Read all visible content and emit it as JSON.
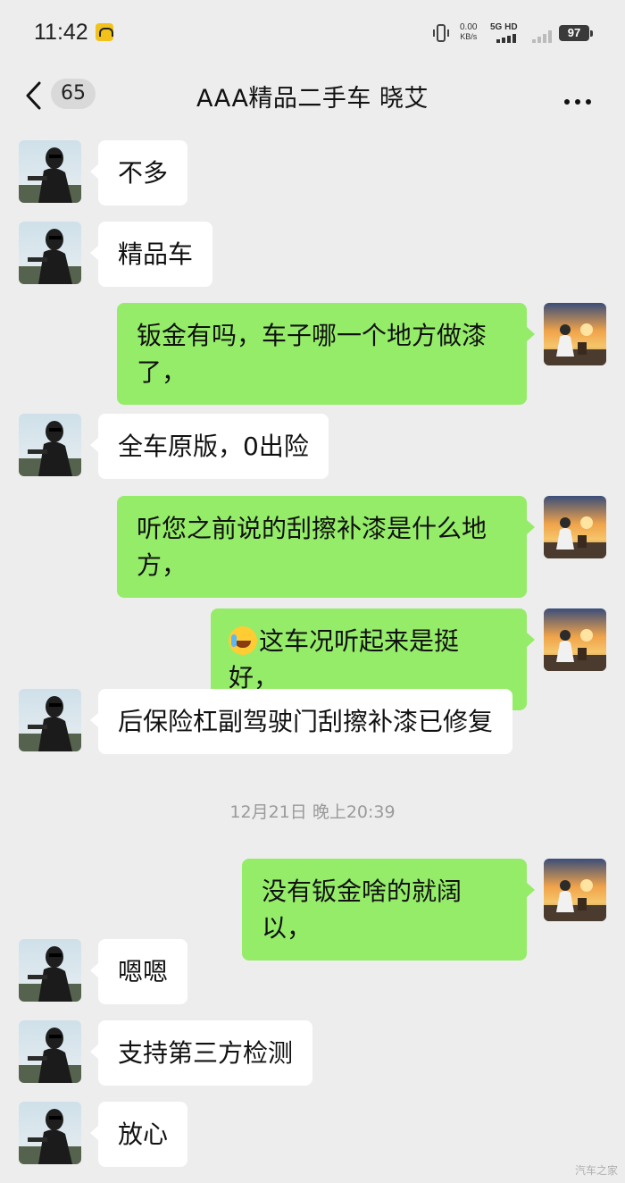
{
  "status_bar": {
    "time": "11:42",
    "net_speed_value": "0.00",
    "net_speed_unit": "KB/s",
    "network_type": "5G HD",
    "battery": "97"
  },
  "header": {
    "unread_count": "65",
    "title": "AAA精品二手车  晓艾",
    "back_icon": "chevron-left-icon",
    "more_icon": "more-horizontal-icon"
  },
  "messages": [
    {
      "side": "left",
      "text": "不多"
    },
    {
      "side": "left",
      "text": "精品车"
    },
    {
      "side": "right",
      "text": "钣金有吗，车子哪一个地方做漆了，"
    },
    {
      "side": "left",
      "text": "全车原版，0出险"
    },
    {
      "side": "right",
      "text": "听您之前说的刮擦补漆是什么地方，"
    },
    {
      "side": "right",
      "text": "这车况听起来是挺好，",
      "emoji": "crying-laughing-face"
    },
    {
      "side": "left",
      "text": "后保险杠副驾驶门刮擦补漆已修复"
    },
    {
      "side": "right",
      "text": "没有钣金啥的就阔以，"
    },
    {
      "side": "left",
      "text": "嗯嗯"
    },
    {
      "side": "left",
      "text": "支持第三方检测"
    },
    {
      "side": "left",
      "text": "放心"
    }
  ],
  "timestamp": "12月21日 晚上20:39",
  "watermark": "汽车之家",
  "colors": {
    "background": "#ededed",
    "incoming_bubble": "#ffffff",
    "outgoing_bubble": "#95ec69"
  }
}
